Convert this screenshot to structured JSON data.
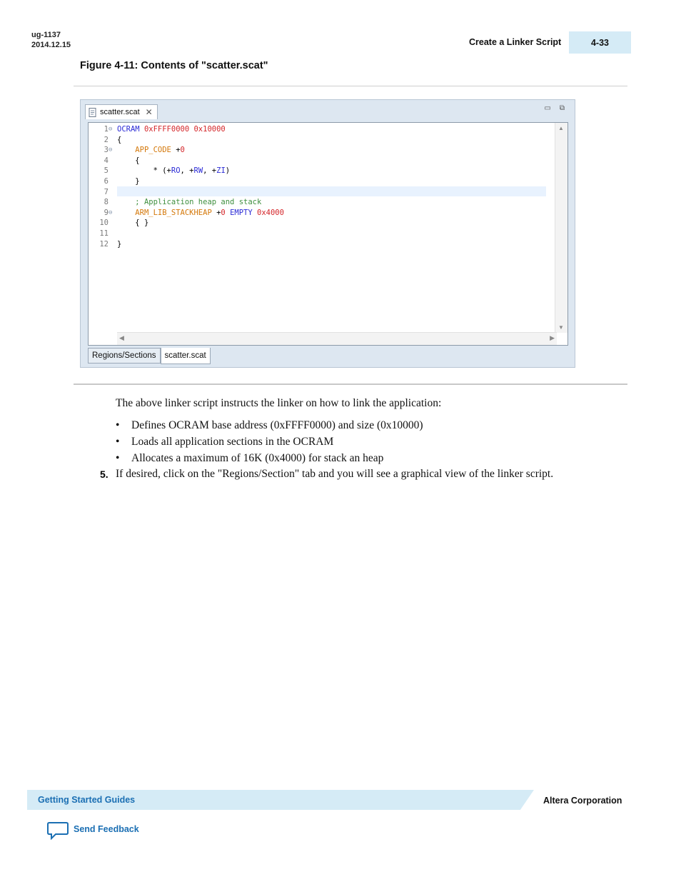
{
  "header": {
    "doc_id": "ug-1137",
    "date": "2014.12.15",
    "section_title": "Create a Linker Script",
    "page_number": "4-33"
  },
  "figure": {
    "caption": "Figure 4-11: Contents of \"scatter.scat\"",
    "editor_tab": "scatter.scat",
    "bottom_tabs": [
      "Regions/Sections",
      "scatter.scat"
    ],
    "line_numbers": [
      "1",
      "2",
      "3",
      "4",
      "5",
      "6",
      "7",
      "8",
      "9",
      "10",
      "11",
      "12"
    ],
    "code": {
      "l1_a": "OCRAM",
      "l1_b": "0xFFFF0000",
      "l1_c": "0x10000",
      "l2": "{",
      "l3_a": "APP_CODE",
      "l3_b": "+",
      "l3_c": "0",
      "l4": "{",
      "l5_a": "* (+",
      "l5_b": "RO",
      "l5_c": ", +",
      "l5_d": "RW",
      "l5_e": ", +",
      "l5_f": "ZI",
      "l5_g": ")",
      "l6": "}",
      "l8": "; Application heap and stack",
      "l9_a": "ARM_LIB_STACKHEAP",
      "l9_b": "+",
      "l9_c": "0",
      "l9_d": "EMPTY",
      "l9_e": "0x4000",
      "l10": "{ }",
      "l12": "}"
    }
  },
  "body": {
    "intro": "The above linker script instructs the linker on how to link the application:",
    "bullets": [
      "Defines OCRAM base address (0xFFFF0000) and size (0x10000)",
      "Loads all application sections in the OCRAM",
      "Allocates a maximum of 16K (0x4000) for stack an heap"
    ],
    "step_number": "5.",
    "step_text": "If desired, click on the \"Regions/Section\" tab and you will see a graphical view of the linker script."
  },
  "footer": {
    "guide": "Getting Started Guides",
    "company": "Altera Corporation",
    "feedback": "Send Feedback"
  }
}
